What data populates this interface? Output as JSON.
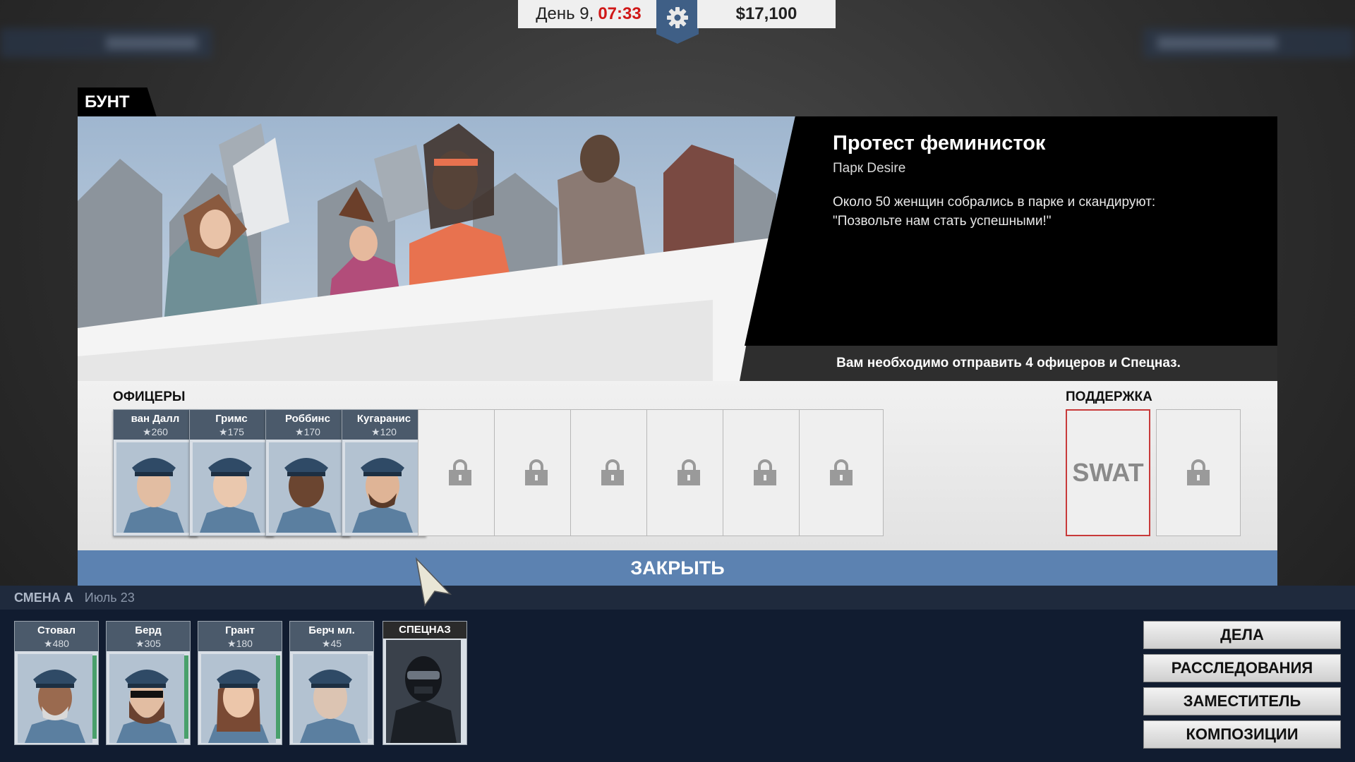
{
  "hud": {
    "day_label": "День 9,",
    "time": "07:33",
    "money": "$17,100"
  },
  "event": {
    "tag": "БУНТ",
    "title": "Протест феминисток",
    "location": "Парк Desire",
    "description": "Около 50 женщин собрались в парке и скандируют: \"Позвольте нам стать успешными!\"",
    "requirement": "Вам необходимо отправить 4 офицеров и Спецназ."
  },
  "officers_section": {
    "label": "ОФИЦЕРЫ",
    "assigned": [
      {
        "name": "ван Далл",
        "rating": "260"
      },
      {
        "name": "Гримс",
        "rating": "175"
      },
      {
        "name": "Роббинс",
        "rating": "170"
      },
      {
        "name": "Кугаранис",
        "rating": "120"
      }
    ]
  },
  "support_section": {
    "label": "ПОДДЕРЖКА",
    "swat_label": "SWAT"
  },
  "close_label": "ЗАКРЫТЬ",
  "shift": {
    "name": "СМЕНА А",
    "date": "Июль 23",
    "roster": [
      {
        "name": "Стовал",
        "rating": "480"
      },
      {
        "name": "Берд",
        "rating": "305"
      },
      {
        "name": "Грант",
        "rating": "180"
      },
      {
        "name": "Берч мл.",
        "rating": "45"
      }
    ],
    "swat_label": "СПЕЦНАЗ"
  },
  "menu": {
    "cases": "ДЕЛА",
    "investigations": "РАССЛЕДОВАНИЯ",
    "deputy": "ЗАМЕСТИТЕЛЬ",
    "compositions": "КОМПОЗИЦИИ"
  },
  "icons": {
    "gear": "gear-icon",
    "lock": "lock-icon",
    "star": "star-icon"
  },
  "colors": {
    "accent_blue": "#5c82b1",
    "time_red": "#d01818",
    "swat_border": "#c83a3a"
  }
}
